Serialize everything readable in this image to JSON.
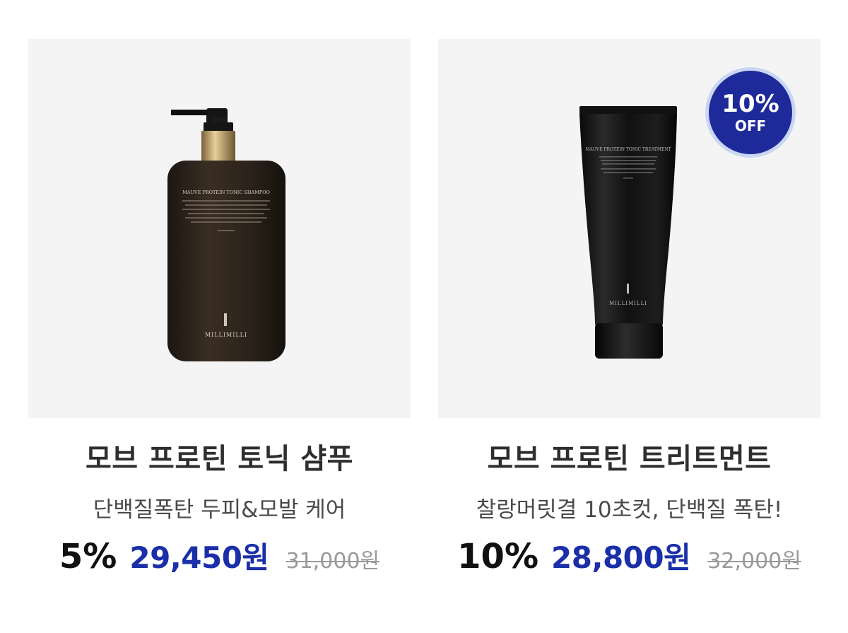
{
  "products": [
    {
      "title": "모브 프로틴 토닉 샴푸",
      "subtitle": "단백질폭탄 두피&모발 케어",
      "discount": "5%",
      "sale_price": "29,450원",
      "original_price": "31,000원",
      "label": {
        "name": "MAUVE PROTEIN TONIC SHAMPOO",
        "brand": "MILLIMILLI"
      }
    },
    {
      "title": "모브 프로틴 트리트먼트",
      "subtitle": "찰랑머릿결 10초컷, 단백질 폭탄!",
      "discount": "10%",
      "sale_price": "28,800원",
      "original_price": "32,000원",
      "badge": {
        "percent": "10%",
        "off": "OFF"
      },
      "label": {
        "name": "MAUVE PROTEIN TONIC TREATMENT",
        "brand": "MILLIMILLI"
      }
    }
  ],
  "colors": {
    "sale_price": "#1a2fa8",
    "badge_bg": "#1f2a9a",
    "badge_ring": "#c9d7f4",
    "image_bg": "#f4f4f4"
  },
  "icons": [
    "shampoo-bottle-image",
    "treatment-tube-image",
    "discount-badge"
  ]
}
